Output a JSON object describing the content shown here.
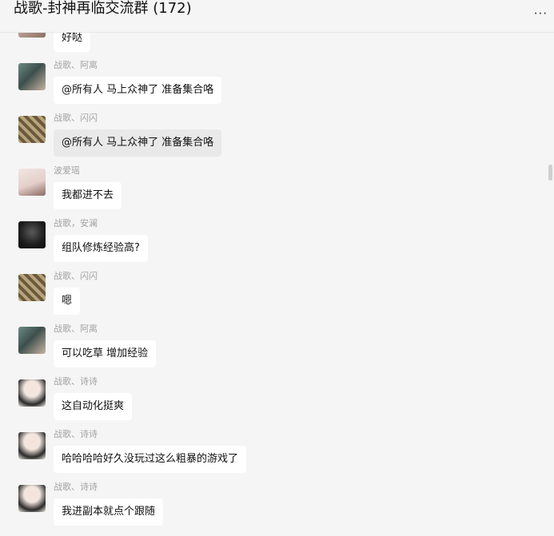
{
  "header": {
    "title": "战歌-封神再临交流群 (172)",
    "more_label": "···"
  },
  "messages": [
    {
      "sender": "",
      "text": "好哒",
      "avatar": "avatar-image"
    },
    {
      "sender": "战歌、阿离",
      "text": "@所有人 马上众神了 准备集合咯",
      "avatar": "avatar-image"
    },
    {
      "sender": "战歌、闪闪",
      "text": "@所有人 马上众神了 准备集合咯",
      "avatar": "avatar-image"
    },
    {
      "sender": "波爱瑶",
      "text": "我都进不去",
      "avatar": "avatar-image"
    },
    {
      "sender": "战歌，安澜",
      "text": "组队修炼经验高?",
      "avatar": "avatar-image"
    },
    {
      "sender": "战歌、闪闪",
      "text": "嗯",
      "avatar": "avatar-image"
    },
    {
      "sender": "战歌、阿离",
      "text": "可以吃草 增加经验",
      "avatar": "avatar-image"
    },
    {
      "sender": "战歌、诗诗",
      "text": "这自动化挺爽",
      "avatar": "avatar-image"
    },
    {
      "sender": "战歌、诗诗",
      "text": "哈哈哈哈好久没玩过这么粗暴的游戏了",
      "avatar": "avatar-image"
    },
    {
      "sender": "战歌、诗诗",
      "text": "我进副本就点个跟随",
      "avatar": "avatar-image"
    }
  ]
}
